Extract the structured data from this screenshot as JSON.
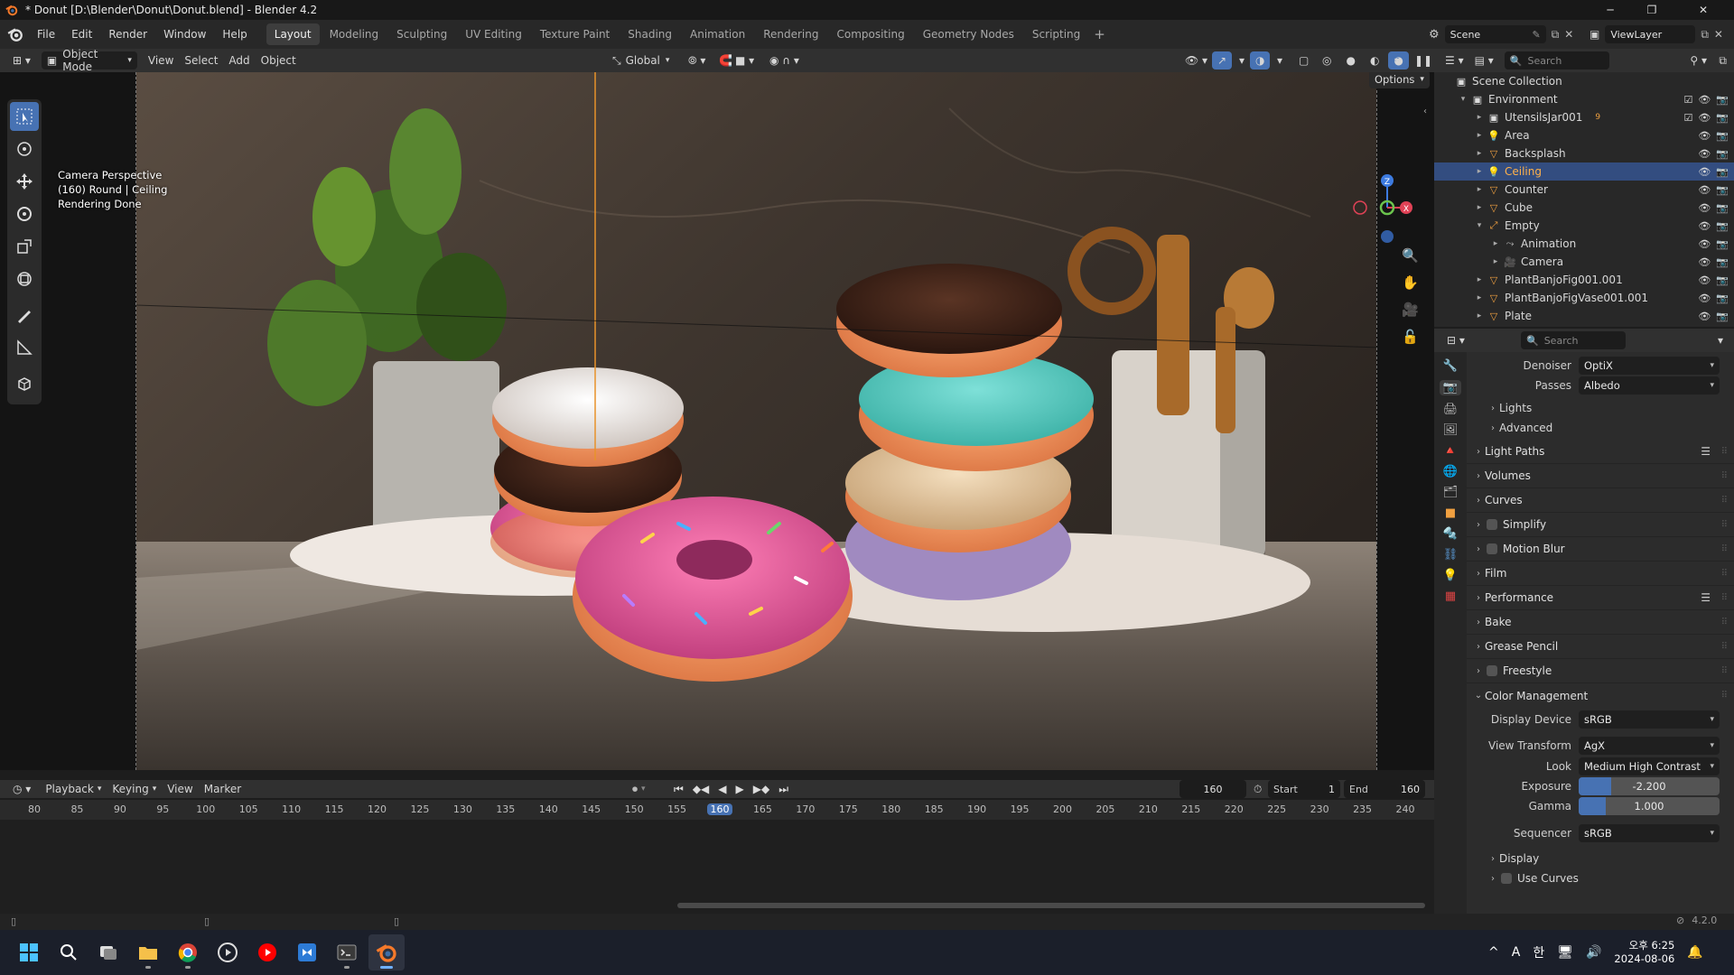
{
  "window": {
    "title": "* Donut [D:\\Blender\\Donut\\Donut.blend] - Blender 4.2",
    "minimize": "─",
    "restore": "❐",
    "close": "✕"
  },
  "menu": [
    "File",
    "Edit",
    "Render",
    "Window",
    "Help"
  ],
  "workspaces": [
    "Layout",
    "Modeling",
    "Sculpting",
    "UV Editing",
    "Texture Paint",
    "Shading",
    "Animation",
    "Rendering",
    "Compositing",
    "Geometry Nodes",
    "Scripting"
  ],
  "active_workspace": "Layout",
  "add_workspace": "+",
  "scene": {
    "name": "Scene",
    "view_layer": "ViewLayer"
  },
  "viewport_header": {
    "mode": "Object Mode",
    "menus": [
      "View",
      "Select",
      "Add",
      "Object"
    ],
    "orientation": "Global",
    "options": "Options"
  },
  "viewport_info": [
    "Camera Perspective",
    "(160) Round | Ceiling",
    "Rendering Done"
  ],
  "gizmo": {
    "z": "Z",
    "x": "X"
  },
  "outliner": {
    "search_placeholder": "Search",
    "rows": [
      {
        "name": "Scene Collection",
        "depth": 0,
        "icon": "collection-icon",
        "arrow": ""
      },
      {
        "name": "Environment",
        "depth": 1,
        "icon": "collection-icon",
        "arrow": "▾"
      },
      {
        "name": "UtensilsJar001",
        "depth": 2,
        "icon": "collection-icon",
        "arrow": "▸",
        "badge": "9"
      },
      {
        "name": "Area",
        "depth": 2,
        "icon": "light-icon",
        "arrow": "▸"
      },
      {
        "name": "Backsplash",
        "depth": 2,
        "icon": "mesh-icon",
        "arrow": "▸"
      },
      {
        "name": "Ceiling",
        "depth": 2,
        "icon": "light-icon",
        "arrow": "▸",
        "selected": true
      },
      {
        "name": "Counter",
        "depth": 2,
        "icon": "mesh-icon",
        "arrow": "▸"
      },
      {
        "name": "Cube",
        "depth": 2,
        "icon": "mesh-icon",
        "arrow": "▸"
      },
      {
        "name": "Empty",
        "depth": 2,
        "icon": "empty-icon",
        "arrow": "▾"
      },
      {
        "name": "Animation",
        "depth": 3,
        "icon": "action-icon",
        "arrow": "▸"
      },
      {
        "name": "Camera",
        "depth": 3,
        "icon": "camera-icon",
        "arrow": "▸"
      },
      {
        "name": "PlantBanjoFig001.001",
        "depth": 2,
        "icon": "mesh-icon",
        "arrow": "▸"
      },
      {
        "name": "PlantBanjoFigVase001.001",
        "depth": 2,
        "icon": "mesh-icon",
        "arrow": "▸"
      },
      {
        "name": "Plate",
        "depth": 2,
        "icon": "mesh-icon",
        "arrow": "▸"
      }
    ]
  },
  "properties": {
    "search_placeholder": "Search",
    "denoiser_label": "Denoiser",
    "denoiser_value": "OptiX",
    "passes_label": "Passes",
    "passes_value": "Albedo",
    "sub_lights": "Lights",
    "sub_advanced": "Advanced",
    "sections": [
      {
        "label": "Light Paths",
        "checkbox": false,
        "list": true
      },
      {
        "label": "Volumes",
        "checkbox": false
      },
      {
        "label": "Curves",
        "checkbox": false
      },
      {
        "label": "Simplify",
        "checkbox": true
      },
      {
        "label": "Motion Blur",
        "checkbox": true
      },
      {
        "label": "Film",
        "checkbox": false
      },
      {
        "label": "Performance",
        "checkbox": false,
        "list": true
      },
      {
        "label": "Bake",
        "checkbox": false
      },
      {
        "label": "Grease Pencil",
        "checkbox": false
      },
      {
        "label": "Freestyle",
        "checkbox": true
      }
    ],
    "color_management": "Color Management",
    "display_device_label": "Display Device",
    "display_device_value": "sRGB",
    "view_transform_label": "View Transform",
    "view_transform_value": "AgX",
    "look_label": "Look",
    "look_value": "Medium High Contrast",
    "exposure_label": "Exposure",
    "exposure_value": "-2.200",
    "exposure_fill": 0.23,
    "gamma_label": "Gamma",
    "gamma_value": "1.000",
    "gamma_fill": 0.19,
    "sequencer_label": "Sequencer",
    "sequencer_value": "sRGB",
    "sub_display": "Display",
    "sub_use_curves": "Use Curves"
  },
  "timeline": {
    "menus": [
      "Playback",
      "Keying",
      "View",
      "Marker"
    ],
    "current_frame": "160",
    "start_label": "Start",
    "start": "1",
    "end_label": "End",
    "end": "160",
    "ruler": [
      "80",
      "85",
      "90",
      "95",
      "100",
      "105",
      "110",
      "115",
      "120",
      "125",
      "130",
      "135",
      "140",
      "145",
      "150",
      "155",
      "160",
      "165",
      "170",
      "175",
      "180",
      "185",
      "190",
      "195",
      "200",
      "205",
      "210",
      "215",
      "220",
      "225",
      "230",
      "235",
      "240"
    ],
    "ruler_min": 80,
    "ruler_max": 240
  },
  "status": {
    "version": "4.2.0"
  },
  "taskbar": {
    "time": "오후 6:25",
    "date": "2024-08-06",
    "ime_lang": "A",
    "ime_mode": "한",
    "tray_caret": "^"
  },
  "colors": {
    "accent": "#4772b3",
    "selection": "#334d80",
    "selected_text": "#ffb14a",
    "playhead": "#4772b3"
  }
}
